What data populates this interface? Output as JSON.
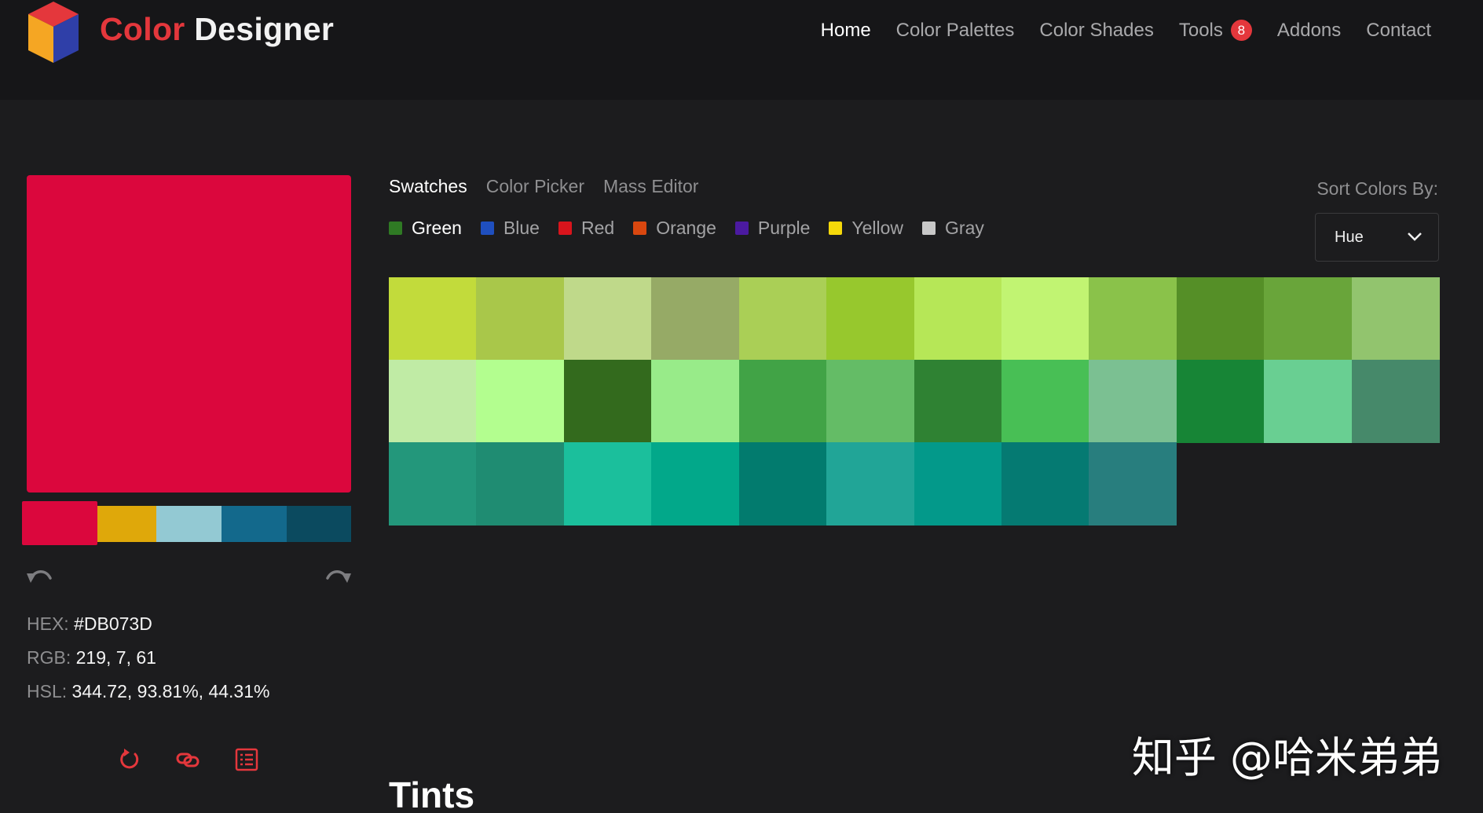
{
  "header": {
    "brand_part1": "Color",
    "brand_part2": "Designer",
    "logo_icon": "cube-logo-icon",
    "nav": [
      {
        "label": "Home",
        "active": true
      },
      {
        "label": "Color Palettes"
      },
      {
        "label": "Color Shades"
      },
      {
        "label": "Tools",
        "badge": "8"
      },
      {
        "label": "Addons"
      },
      {
        "label": "Contact"
      }
    ],
    "accent_color": "#e4373c"
  },
  "selected_color": {
    "hex_label": "HEX:",
    "hex": "#DB073D",
    "rgb_label": "RGB:",
    "rgb": "219, 7, 61",
    "hsl_label": "HSL:",
    "hsl": "344.72, 93.81%, 44.31%",
    "swatch": "#DB073D"
  },
  "palette": [
    "#DB073D",
    "#DFA80A",
    "#93C9D3",
    "#13698C",
    "#0B4A5F"
  ],
  "icons": {
    "undo": "undo-icon",
    "redo": "redo-icon",
    "actions": [
      "refresh-icon",
      "link-icon",
      "list-icon"
    ]
  },
  "tabs": [
    {
      "label": "Swatches",
      "active": true
    },
    {
      "label": "Color Picker"
    },
    {
      "label": "Mass Editor"
    }
  ],
  "filters": [
    {
      "label": "Green",
      "color": "#2f7a24",
      "active": true
    },
    {
      "label": "Blue",
      "color": "#1f4fbf"
    },
    {
      "label": "Red",
      "color": "#d9141c"
    },
    {
      "label": "Orange",
      "color": "#d9470f"
    },
    {
      "label": "Purple",
      "color": "#4b1aa0"
    },
    {
      "label": "Yellow",
      "color": "#f5d80a"
    },
    {
      "label": "Gray",
      "color": "#c8c8c8"
    }
  ],
  "sort": {
    "label": "Sort Colors By:",
    "value": "Hue"
  },
  "swatch_rows": [
    [
      "#C2DB3B",
      "#A9C74A",
      "#BFD98A",
      "#96AA66",
      "#AACF56",
      "#97C82D",
      "#B6E757",
      "#C1F472",
      "#8AC24A",
      "#558F27",
      "#69A53A",
      "#92C46E"
    ],
    [
      "#C0EBA5",
      "#B3FE8F",
      "#336A1D",
      "#98EB89",
      "#41A346",
      "#64BC66",
      "#2F8233",
      "#48BF55",
      "#7BC092",
      "#178536",
      "#69CF92",
      "#46896A"
    ],
    [
      "#23977B",
      "#1F8C72",
      "#1BBF9C",
      "#02A88A",
      "#027B6E",
      "#21A597",
      "#03998A",
      "#057A72",
      "#287E7E"
    ]
  ],
  "section_heading": "Tints",
  "watermark": "知乎 @哈米弟弟"
}
